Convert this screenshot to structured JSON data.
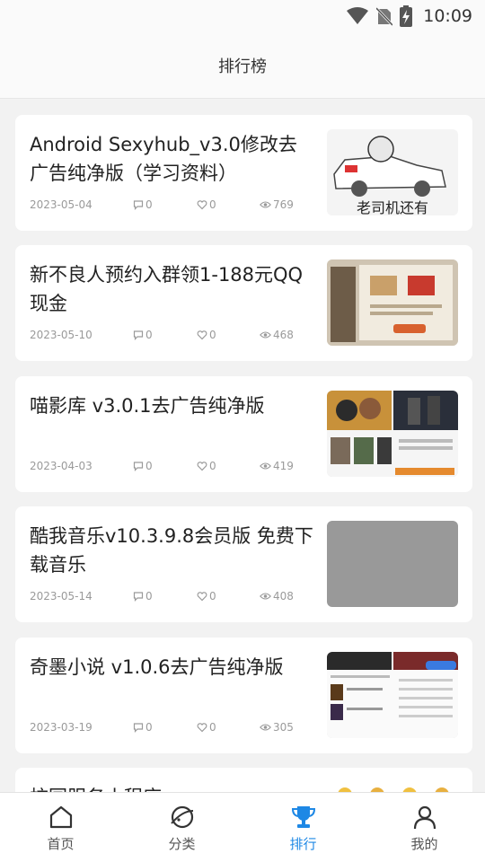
{
  "status_bar": {
    "time": "10:09",
    "icons": [
      "wifi-icon",
      "no-sim-icon",
      "battery-charging-icon"
    ]
  },
  "header": {
    "title": "排行榜"
  },
  "articles": [
    {
      "title": "Android Sexyhub_v3.0修改去广告纯净版（学习资料）",
      "date": "2023-05-04",
      "comments": "0",
      "likes": "0",
      "views": "769",
      "thumb_text": "老司机还有"
    },
    {
      "title": "新不良人预约入群领1-188元QQ现金",
      "date": "2023-05-10",
      "comments": "0",
      "likes": "0",
      "views": "468"
    },
    {
      "title": "喵影库 v3.0.1去广告纯净版",
      "date": "2023-04-03",
      "comments": "0",
      "likes": "0",
      "views": "419"
    },
    {
      "title": "酷我音乐v10.3.9.8会员版 免费下载音乐",
      "date": "2023-05-14",
      "comments": "0",
      "likes": "0",
      "views": "408"
    },
    {
      "title": "奇墨小说 v1.0.6去广告纯净版",
      "date": "2023-03-19",
      "comments": "0",
      "likes": "0",
      "views": "305"
    },
    {
      "title": "校园服务小程序",
      "date": "",
      "comments": "",
      "likes": "",
      "views": ""
    }
  ],
  "nav": {
    "items": [
      {
        "label": "首页",
        "icon": "home-icon"
      },
      {
        "label": "分类",
        "icon": "planet-icon"
      },
      {
        "label": "排行",
        "icon": "trophy-icon"
      },
      {
        "label": "我的",
        "icon": "user-icon"
      }
    ],
    "active_index": 2,
    "active_color": "#1e88e5"
  }
}
